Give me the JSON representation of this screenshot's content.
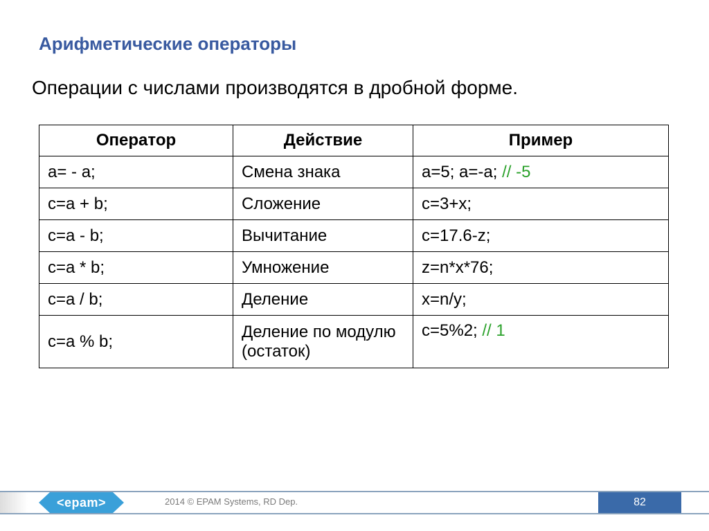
{
  "title": "Арифметические операторы",
  "subtitle": "Операции с числами производятся в дробной форме.",
  "headers": {
    "op": "Оператор",
    "act": "Действие",
    "ex": "Пример"
  },
  "rows": [
    {
      "op": "a= - a;",
      "act": "Смена знака",
      "ex": "a=5; a=-a; ",
      "comment": "// -5"
    },
    {
      "op": "c=a + b;",
      "act": "Сложение",
      "ex": "c=3+x;",
      "comment": ""
    },
    {
      "op": "c=a - b;",
      "act": "Вычитание",
      "ex": "c=17.6-z;",
      "comment": ""
    },
    {
      "op": "c=a * b;",
      "act": "Умножение",
      "ex": "z=n*x*76;",
      "comment": ""
    },
    {
      "op": "c=a / b;",
      "act": "Деление",
      "ex": "x=n/y;",
      "comment": ""
    },
    {
      "op": "c=a % b;",
      "act": "Деление по модулю (остаток)",
      "ex": "c=5%2; ",
      "comment": "// 1"
    }
  ],
  "footer": {
    "logo": "<epam>",
    "copyright": "2014 © EPAM Systems, RD Dep.",
    "page": "82"
  }
}
